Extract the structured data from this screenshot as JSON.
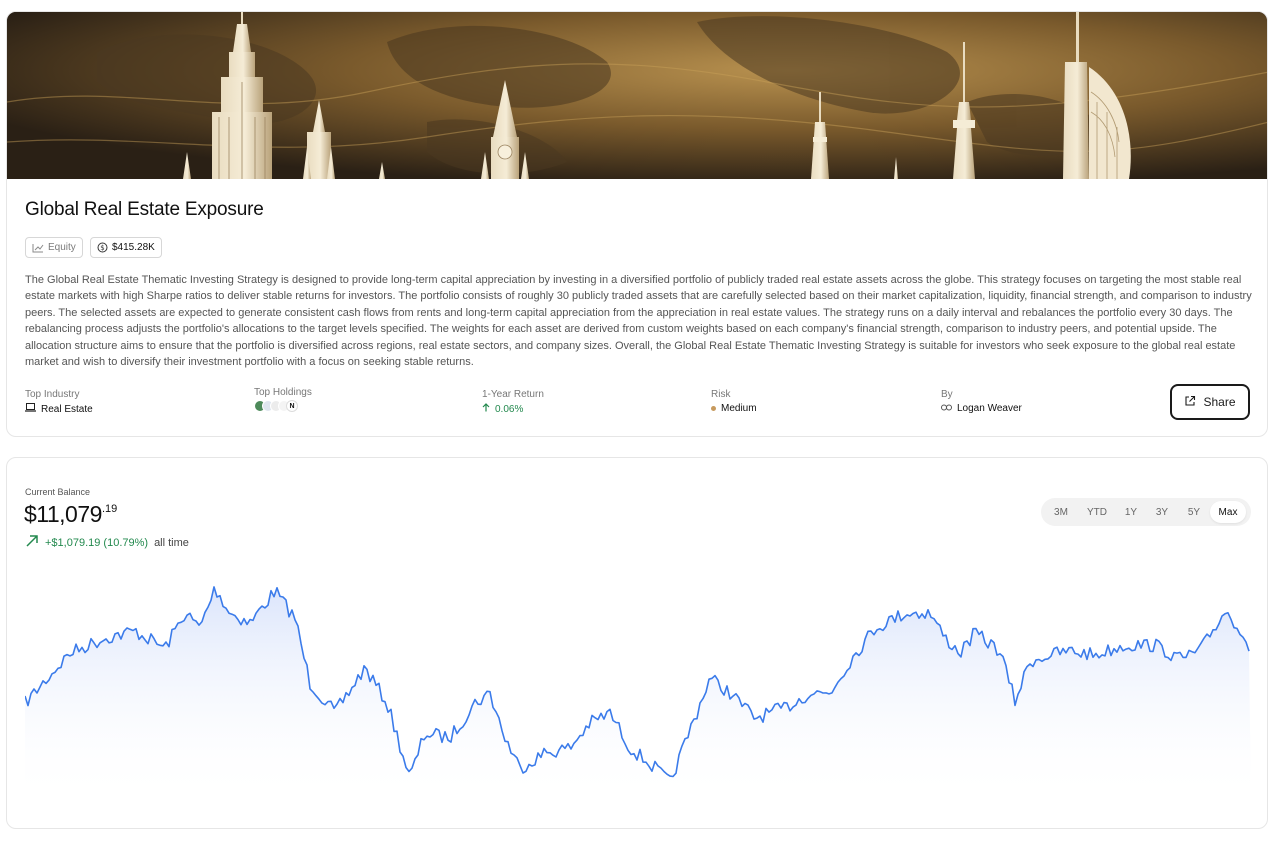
{
  "strategy": {
    "title": "Global Real Estate Exposure",
    "asset_class": "Equity",
    "aum": "$415.28K",
    "description": "The Global Real Estate Thematic Investing Strategy is designed to provide long-term capital appreciation by investing in a diversified portfolio of publicly traded real estate assets across the globe. This strategy focuses on targeting the most stable real estate markets with high Sharpe ratios to deliver stable returns for investors. The portfolio consists of roughly 30 publicly traded assets that are carefully selected based on their market capitalization, liquidity, financial strength, and comparison to industry peers. The selected assets are expected to generate consistent cash flows from rents and long-term capital appreciation from the appreciation in real estate values. The strategy runs on a daily interval and rebalances the portfolio every 30 days. The rebalancing process adjusts the portfolio's allocations to the target levels specified. The weights for each asset are derived from custom weights based on each company's financial strength, comparison to industry peers, and potential upside. The allocation structure aims to ensure that the portfolio is diversified across regions, real estate sectors, and company sizes. Overall, the Global Real Estate Thematic Investing Strategy is suitable for investors who seek exposure to the global real estate market and wish to diversify their investment portfolio with a focus on seeking stable returns.",
    "stats": {
      "top_industry_label": "Top Industry",
      "top_industry_value": "Real Estate",
      "top_holdings_label": "Top Holdings",
      "one_year_label": "1-Year Return",
      "one_year_value": "0.06%",
      "risk_label": "Risk",
      "risk_value": "Medium",
      "by_label": "By",
      "by_value": "Logan Weaver"
    },
    "share_label": "Share"
  },
  "balance": {
    "label": "Current Balance",
    "whole": "$11,079",
    "cents": ".19",
    "change": "+$1,079.19 (10.79%)",
    "period": "all time"
  },
  "ranges": [
    "3M",
    "YTD",
    "1Y",
    "3Y",
    "5Y",
    "Max"
  ],
  "active_range": "Max",
  "colors": {
    "line": "#3b7bea",
    "positive": "#23894e",
    "risk_medium": "#c79a5e"
  }
}
